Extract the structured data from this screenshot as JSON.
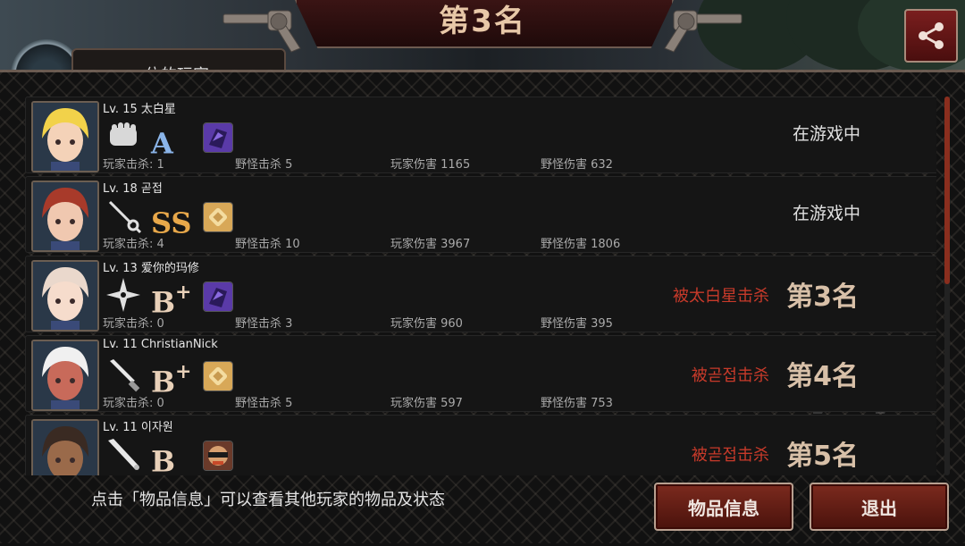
{
  "header": {
    "title": "第3名",
    "tab_label": "一位的玩家"
  },
  "rows": [
    {
      "level_name": "Lv. 15  太白星",
      "weapon_icon": "fist-icon",
      "grade": "A",
      "grade_plus": "",
      "grade_color": "#8ab4e8",
      "item_icon": "purple-shard-icon",
      "item_color": "#5a3aa8",
      "player_kills": "玩家击杀: 1",
      "monster_kills": "野怪击杀 5",
      "player_damage": "玩家伤害 1165",
      "monster_damage": "野怪伤害 632",
      "status": "在游戏中",
      "killed_by": "",
      "rank": "",
      "hair": "#f2d24a",
      "skin": "#f4d2b8"
    },
    {
      "level_name": "Lv. 18  곧접",
      "weapon_icon": "rapier-icon",
      "grade": "SS",
      "grade_plus": "",
      "grade_color": "#e8a84a",
      "item_icon": "golden-bandage-icon",
      "item_color": "#d8a858",
      "player_kills": "玩家击杀: 4",
      "monster_kills": "野怪击杀 10",
      "player_damage": "玩家伤害 3967",
      "monster_damage": "野怪伤害 1806",
      "status": "在游戏中",
      "killed_by": "",
      "rank": "",
      "hair": "#a83a2a",
      "skin": "#f0c8b0"
    },
    {
      "level_name": "Lv. 13  爱你的玛修",
      "weapon_icon": "shuriken-icon",
      "grade": "B",
      "grade_plus": "+",
      "grade_color": "#e8d0b8",
      "item_icon": "purple-shard-icon",
      "item_color": "#5a3aa8",
      "player_kills": "玩家击杀: 0",
      "monster_kills": "野怪击杀 3",
      "player_damage": "玩家伤害 960",
      "monster_damage": "野怪伤害 395",
      "status": "",
      "killed_by": "被太白星击杀",
      "rank": "第3名",
      "hair": "#ead8cc",
      "skin": "#f6dccc"
    },
    {
      "level_name": "Lv. 11  ChristianNick",
      "weapon_icon": "knife-icon",
      "grade": "B",
      "grade_plus": "+",
      "grade_color": "#e8d0b8",
      "item_icon": "golden-bandage-icon",
      "item_color": "#d8a858",
      "player_kills": "玩家击杀: 0",
      "monster_kills": "野怪击杀 5",
      "player_damage": "玩家伤害 597",
      "monster_damage": "野怪伤害 753",
      "status": "",
      "killed_by": "被곧접击杀",
      "rank": "第4名",
      "hair": "#f0f0f0",
      "skin": "#c86a5a"
    },
    {
      "level_name": "Lv. 11  이자원",
      "weapon_icon": "bat-icon",
      "grade": "B",
      "grade_plus": "",
      "grade_color": "#e8d0b8",
      "item_icon": "masked-face-icon",
      "item_color": "#c84a2a",
      "player_kills": "",
      "monster_kills": "",
      "player_damage": "",
      "monster_damage": "",
      "status": "",
      "killed_by": "被곧접击杀",
      "rank": "第5名",
      "hair": "#3a2a22",
      "skin": "#9a6a4a"
    }
  ],
  "footer": {
    "hint": "点击「物品信息」可以查看其他玩家的物品及状态",
    "items_button": "物品信息",
    "exit_button": "退出"
  }
}
